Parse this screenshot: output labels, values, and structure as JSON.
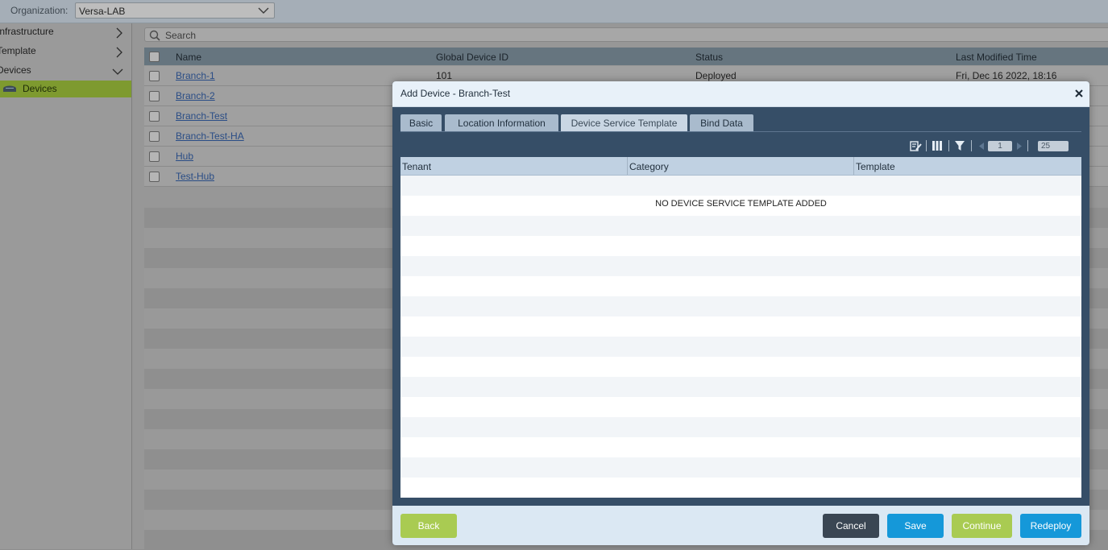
{
  "topbar": {
    "org_label": "Organization:",
    "org_value": "Versa-LAB"
  },
  "sidebar": {
    "items": [
      {
        "label": "Infrastructure"
      },
      {
        "label": "Template"
      },
      {
        "label": "Devices"
      },
      {
        "label": "Devices"
      }
    ]
  },
  "search": {
    "placeholder": "Search"
  },
  "grid": {
    "columns": [
      "Name",
      "Global Device ID",
      "Status",
      "Last Modified Time"
    ],
    "rows": [
      {
        "name": "Branch-1",
        "id": "101",
        "status": "Deployed",
        "modified": "Fri, Dec 16 2022, 18:16"
      },
      {
        "name": "Branch-2",
        "id": "",
        "status": "",
        "modified": ""
      },
      {
        "name": "Branch-Test",
        "id": "",
        "status": "",
        "modified": ""
      },
      {
        "name": "Branch-Test-HA",
        "id": "",
        "status": "",
        "modified": ""
      },
      {
        "name": "Hub",
        "id": "",
        "status": "",
        "modified": ""
      },
      {
        "name": "Test-Hub",
        "id": "",
        "status": "",
        "modified": ""
      }
    ]
  },
  "modal": {
    "title": "Add Device - Branch-Test",
    "tabs": [
      "Basic",
      "Location Information",
      "Device Service Template",
      "Bind Data"
    ],
    "active_tab": "Device Service Template",
    "toolbar": {
      "page": "1",
      "page_size": "25"
    },
    "table": {
      "columns": [
        "Tenant",
        "Category",
        "Template"
      ],
      "empty_message": "NO DEVICE SERVICE TEMPLATE ADDED"
    },
    "buttons": {
      "back": "Back",
      "cancel": "Cancel",
      "save": "Save",
      "continue": "Continue",
      "redeploy": "Redeploy"
    }
  },
  "colors": {
    "modal_body": "#364e67",
    "primary_button": "#1598d9",
    "green_button": "#a9cb52",
    "cancel_button": "#3a4653",
    "active_sidebar": "#7e9a2f"
  }
}
